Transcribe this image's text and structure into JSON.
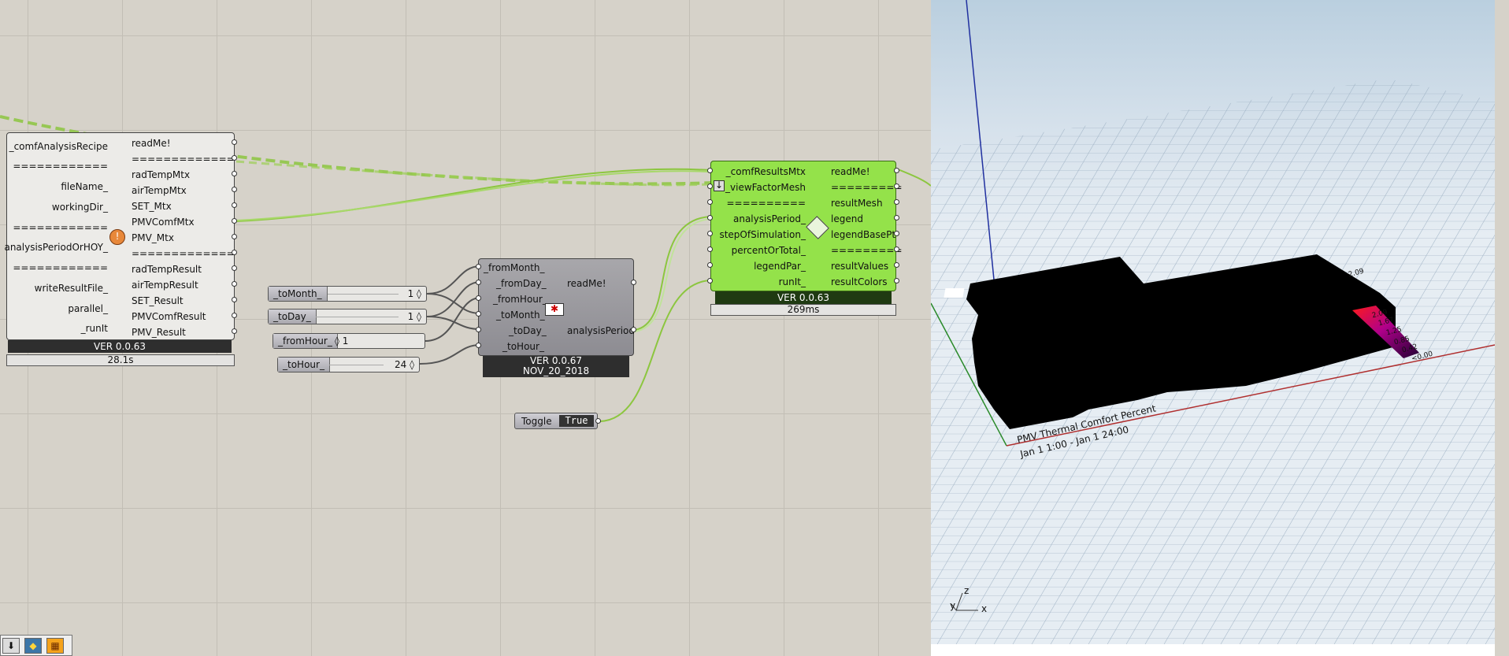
{
  "recipe_component": {
    "inputs": [
      "_comfAnalysisRecipe",
      "============",
      "fileName_",
      "workingDir_",
      "============",
      "analysisPeriodOrHOY_",
      "============",
      "writeResultFile_",
      "parallel_",
      "_runIt"
    ],
    "outputs": [
      "readMe!",
      "=============",
      "radTempMtx",
      "airTempMtx",
      "SET_Mtx",
      "PMVComfMtx",
      "PMV_Mtx",
      "=============",
      "radTempResult",
      "airTempResult",
      "SET_Result",
      "PMVComfResult",
      "PMV_Result"
    ],
    "version": "VER 0.0.63",
    "time": "28.1s"
  },
  "sliders": [
    {
      "name": "_toMonth_",
      "value": "1 ◊"
    },
    {
      "name": "_toDay_",
      "value": "1 ◊"
    },
    {
      "name": "_fromHour_",
      "value": "◊ 1"
    },
    {
      "name": "_toHour_",
      "value": "24 ◊"
    }
  ],
  "period_component": {
    "inputs": [
      "_fromMonth_",
      "_fromDay_",
      "_fromHour_",
      "_toMonth_",
      "_toDay_",
      "_toHour_"
    ],
    "outputs": [
      "readMe!",
      "analysisPeriod"
    ],
    "version": "VER 0.0.67",
    "date": "NOV_20_2018"
  },
  "toggle": {
    "label": "Toggle",
    "value": "True"
  },
  "results_component": {
    "inputs": [
      "_comfResultsMtx",
      "_viewFactorMesh",
      "==========",
      "analysisPeriod_",
      "stepOfSimulation_",
      "percentOrTotal_",
      "legendPar_",
      "runIt_"
    ],
    "outputs": [
      "readMe!",
      "=========",
      "resultMesh",
      "legend",
      "legendBasePt",
      "=========",
      "resultValues",
      "resultColors"
    ],
    "version": "VER 0.0.63",
    "time": "269ms"
  },
  "viewport": {
    "caption_line1": "PMV Thermal Comfort Percent",
    "caption_line2": "Jan 1 1:00 - Jan 1 24:00",
    "legend_values": [
      "2.09",
      "2.09",
      "1.67",
      "1.25",
      "0.85",
      "0.42",
      "<0.00"
    ],
    "axis_x": "x",
    "axis_y": "y",
    "axis_z": "z"
  },
  "colors": {
    "green_component": "#94e24a",
    "canvas": "#d6d2c9",
    "wire_green": "#8cc63f",
    "mesh": "#000000"
  }
}
